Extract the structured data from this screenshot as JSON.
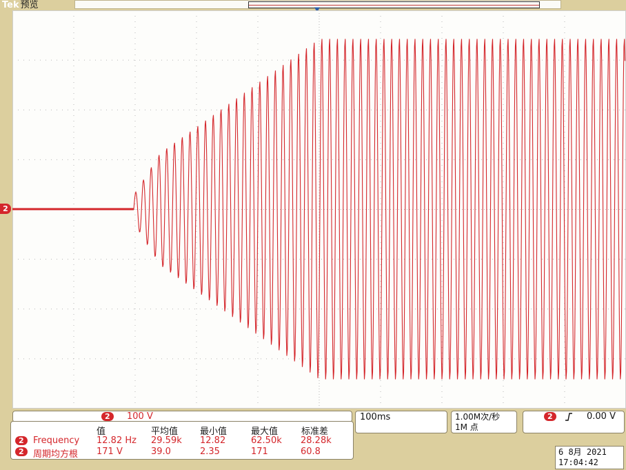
{
  "header": {
    "brand": "Tek",
    "mode": "预览"
  },
  "channel": {
    "number": "2",
    "scale": "100 V",
    "color": "#d4262b"
  },
  "timebase": {
    "scale": "100ms"
  },
  "acquisition": {
    "rate": "1.00M次/秒",
    "record_length": "1M 点"
  },
  "trigger": {
    "channel": "2",
    "slope_icon": "rising-edge-icon",
    "level": "0.00 V"
  },
  "measurements": {
    "headers": [
      "值",
      "平均值",
      "最小值",
      "最大值",
      "标准差"
    ],
    "rows": [
      {
        "channel": "2",
        "name": "Frequency",
        "value": "12.82 Hz",
        "mean": "29.59k",
        "min": "12.82",
        "max": "62.50k",
        "std": "28.28k"
      },
      {
        "channel": "2",
        "name": "周期均方根",
        "value": "171 V",
        "mean": "39.0",
        "min": "2.35",
        "max": "171",
        "std": "60.8"
      }
    ]
  },
  "datetime": {
    "date": "6 8月  2021",
    "time": "17:04:42"
  },
  "waveform": {
    "trace_color": "#d4262b",
    "grid_color": "#b5b5b5",
    "note": ""
  }
}
